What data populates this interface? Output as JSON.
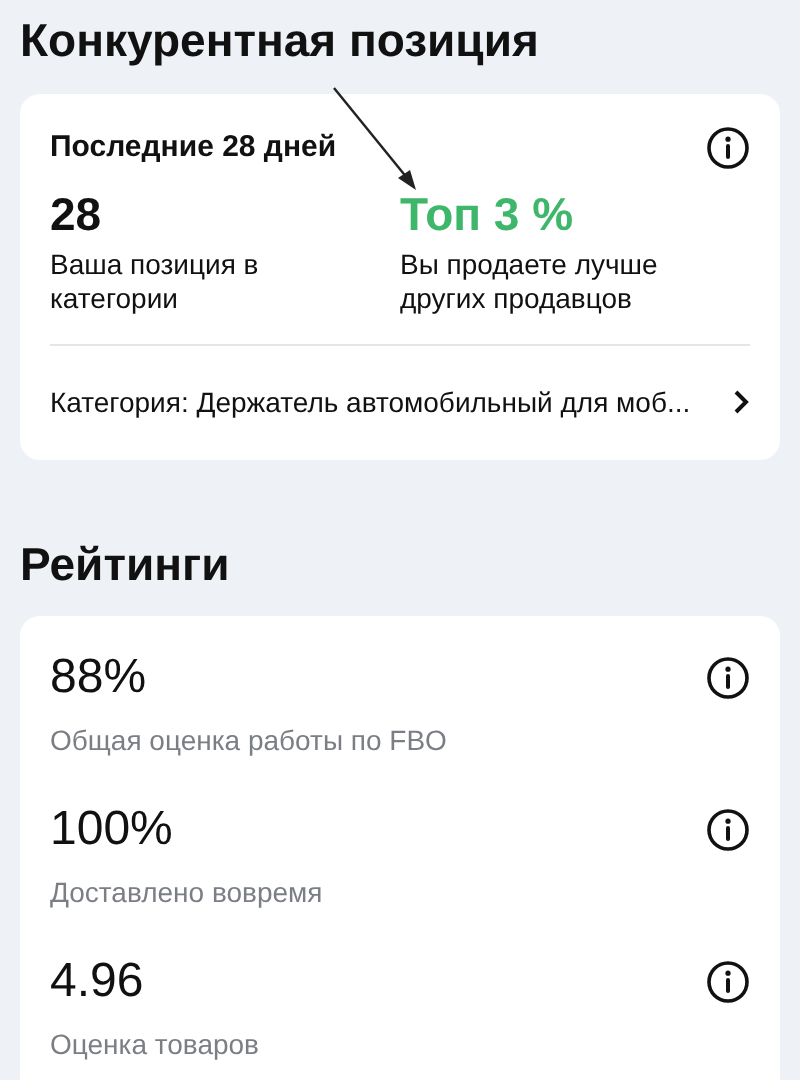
{
  "position": {
    "title": "Конкурентная позиция",
    "period": "Последние 28 дней",
    "stats": [
      {
        "value": "28",
        "caption": "Ваша позиция в категории",
        "highlight": false
      },
      {
        "value": "Топ 3 %",
        "caption": "Вы продаете лучше других продавцов",
        "highlight": true
      }
    ],
    "category": "Категория: Держатель автомобильный для моб..."
  },
  "ratings": {
    "title": "Рейтинги",
    "items": [
      {
        "value": "88%",
        "label": "Общая оценка работы по FBO"
      },
      {
        "value": "100%",
        "label": "Доставлено вовремя"
      },
      {
        "value": "4.96",
        "label": "Оценка товаров"
      }
    ]
  }
}
